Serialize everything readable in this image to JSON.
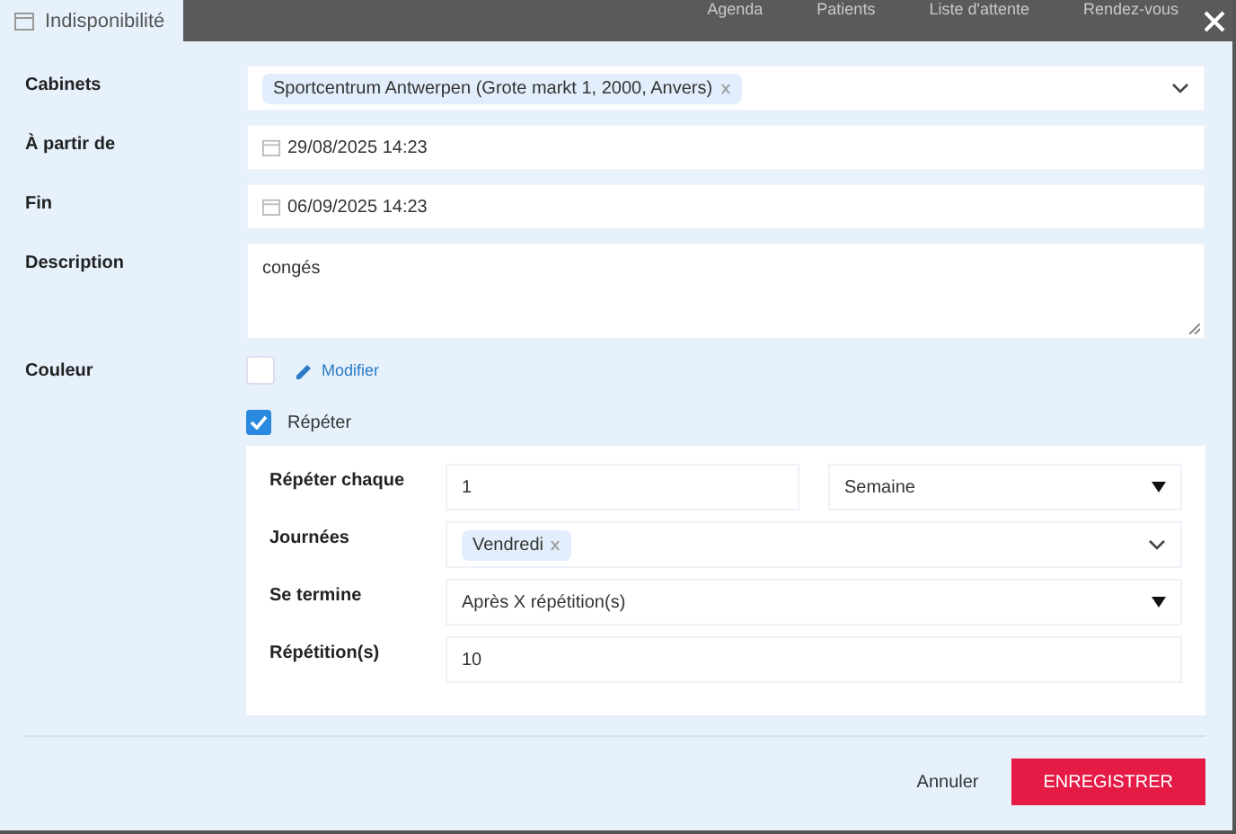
{
  "nav": [
    "Agenda",
    "Patients",
    "Liste d'attente",
    "Rendez-vous"
  ],
  "tab": {
    "title": "Indisponibilité",
    "selected": true
  },
  "form": {
    "cabinets": {
      "label": "Cabinets",
      "tags": [
        "Sportcentrum Antwerpen (Grote markt 1, 2000, Anvers)"
      ]
    },
    "start": {
      "label": "À partir de",
      "value": "29/08/2025 14:23"
    },
    "end": {
      "label": "Fin",
      "value": "06/09/2025 14:23"
    },
    "description": {
      "label": "Description",
      "value": "congés"
    },
    "color": {
      "label": "Couleur",
      "color": "#ffffff",
      "link": "Modifier"
    },
    "repeat": {
      "label": "Répéter",
      "checked": true
    }
  },
  "recurrence": {
    "every": {
      "label": "Répéter chaque",
      "value": "1",
      "unit": "Semaine"
    },
    "days": {
      "label": "Journées",
      "tags": [
        "Vendredi"
      ]
    },
    "ends": {
      "label": "Se termine",
      "value": "Après X répétition(s)"
    },
    "count": {
      "label": "Répétition(s)",
      "value": "10"
    }
  },
  "buttons": {
    "cancel": "Annuler",
    "save": "ENREGISTRER"
  }
}
